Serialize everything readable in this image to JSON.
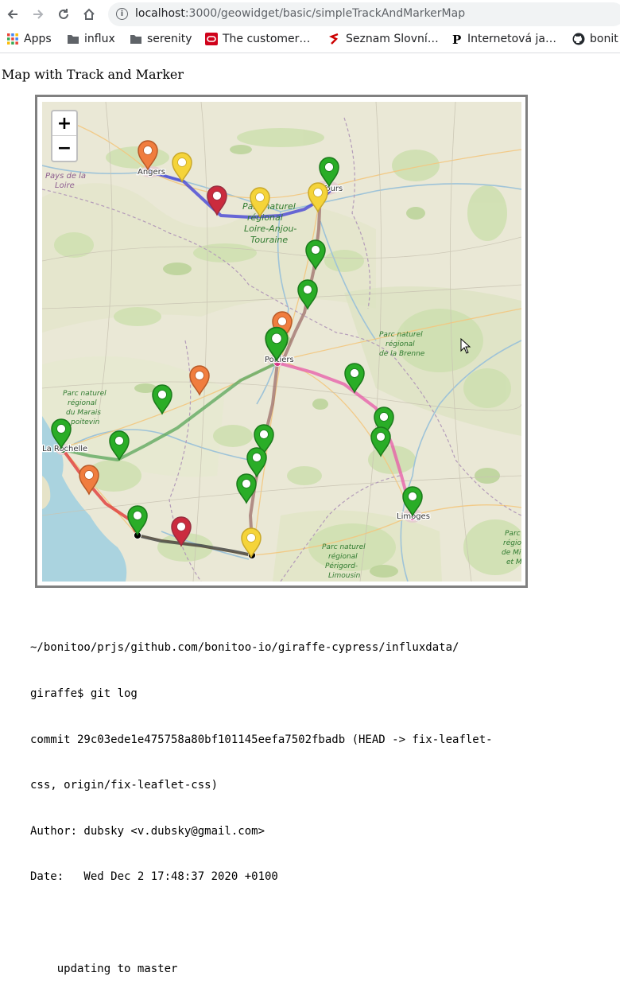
{
  "browser": {
    "url_host": "localhost",
    "url_path": ":3000/geowidget/basic/simpleTrackAndMarkerMap"
  },
  "bookmarks": [
    {
      "label": "Apps",
      "icon": "apps-grid-icon"
    },
    {
      "label": "influx",
      "icon": "folder-icon"
    },
    {
      "label": "serenity",
      "icon": "folder-icon"
    },
    {
      "label": "The customer…",
      "icon": "oracle-icon"
    },
    {
      "label": "Seznam Slovní…",
      "icon": "seznam-icon"
    },
    {
      "label": "Internetová ja…",
      "icon": "p-icon"
    },
    {
      "label": "bonit",
      "icon": "github-icon"
    }
  ],
  "page": {
    "title": "Map with Track and Marker"
  },
  "map": {
    "zoom_in": "+",
    "zoom_out": "−",
    "places": [
      {
        "text": "Angers"
      },
      {
        "text": "Pays de la"
      },
      {
        "text": "Loire"
      },
      {
        "text": "Tours"
      },
      {
        "text": "Parc naturel"
      },
      {
        "text": "régional"
      },
      {
        "text": "Loire-Anjou-"
      },
      {
        "text": "Touraine"
      },
      {
        "text": "Poitiers"
      },
      {
        "text": "Parc naturel"
      },
      {
        "text": "régional"
      },
      {
        "text": "de la Brenne"
      },
      {
        "text": "Parc naturel"
      },
      {
        "text": "régional"
      },
      {
        "text": "du Marais"
      },
      {
        "text": "poitevin"
      },
      {
        "text": "La Rochelle"
      },
      {
        "text": "Limoges"
      },
      {
        "text": "Parc naturel"
      },
      {
        "text": "régional"
      },
      {
        "text": "Périgord-"
      },
      {
        "text": "Limousin"
      },
      {
        "text": "Parc"
      },
      {
        "text": "régional"
      },
      {
        "text": "de Mi"
      },
      {
        "text": "et M"
      }
    ],
    "colors": {
      "green": "#2aad27",
      "orange": "#f07d3f",
      "yellow": "#f5d43a",
      "red": "#cb2b3e",
      "track_blue": "#3b3bd6",
      "track_pink": "#e75aa8",
      "track_green": "#5aa65a",
      "track_red": "#e0302e",
      "track_black": "#333333",
      "track_brown": "#9e6f6a"
    }
  },
  "terminal": {
    "lines": [
      "~/bonitoo/prjs/github.com/bonitoo-io/giraffe-cypress/influxdata/",
      "giraffe$ git log",
      "commit 29c03ede1e475758a80bf101145eefa7502fbadb (HEAD -> fix-leaflet-",
      "css, origin/fix-leaflet-css)",
      "Author: dubsky <v.dubsky@gmail.com>",
      "Date:   Wed Dec 2 17:48:37 2020 +0100",
      "",
      "    updating to master"
    ]
  }
}
